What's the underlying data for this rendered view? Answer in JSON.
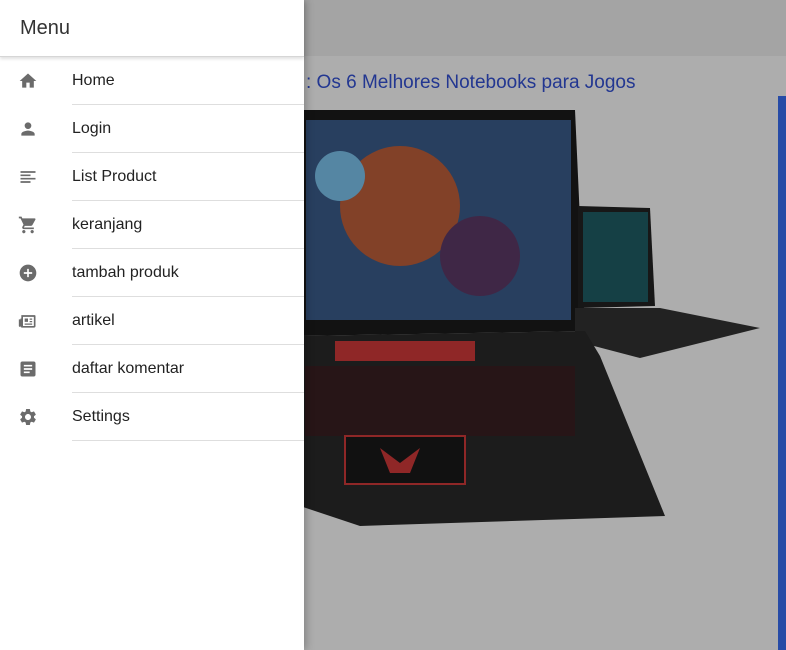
{
  "drawer": {
    "title": "Menu",
    "items": [
      {
        "label": "Home",
        "icon": "home-icon"
      },
      {
        "label": "Login",
        "icon": "person-icon"
      },
      {
        "label": "List Product",
        "icon": "list-icon"
      },
      {
        "label": "keranjang",
        "icon": "cart-icon"
      },
      {
        "label": "tambah produk",
        "icon": "add-circle-icon"
      },
      {
        "label": "artikel",
        "icon": "newspaper-icon"
      },
      {
        "label": "daftar komentar",
        "icon": "document-icon"
      },
      {
        "label": "Settings",
        "icon": "gear-icon"
      }
    ]
  },
  "background": {
    "article_title": ": Os 6 Melhores Notebooks para Jogos"
  },
  "colors": {
    "accent_blue": "#3a6ff5",
    "icon_gray": "#6b6b6b",
    "overlay": "rgba(0,0,0,0.32)"
  }
}
